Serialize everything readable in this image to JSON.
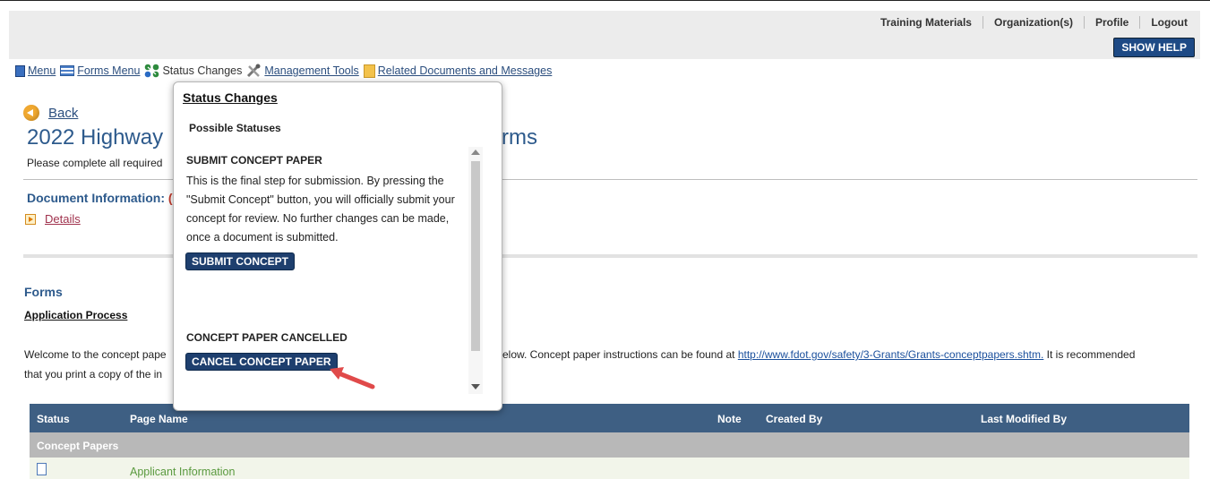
{
  "top_links": [
    "Training Materials",
    "Organization(s)",
    "Profile",
    "Logout"
  ],
  "show_help": "SHOW HELP",
  "menubar": {
    "menu": "Menu",
    "forms_menu": "Forms Menu",
    "status_changes": "Status Changes",
    "management_tools": "Management Tools",
    "related_docs": "Related Documents and Messages"
  },
  "back": "Back",
  "title_left": "2022 Highway",
  "title_right": "rms",
  "subtitle": "Please complete all required",
  "doc_info_label": "Document Information:",
  "doc_info_value": "(",
  "details": "Details",
  "forms_heading": "Forms",
  "application_process": "Application Process",
  "welcome_line1": "Welcome to the concept pape",
  "welcome_line2": "that you print a copy of the in",
  "below_text": "elow. Concept paper instructions can be found at ",
  "below_link": "http://www.fdot.gov/safety/3-Grants/Grants-conceptpapers.shtm.",
  "below_tail": " It is recommended",
  "popup": {
    "title": "Status Changes",
    "subtitle": "Possible Statuses",
    "section1_heading": "SUBMIT CONCEPT PAPER",
    "section1_desc": "This is the final step for submission. By pressing the \"Submit Concept\" button, you will officially submit your concept for review. No further changes can be made, once a document is submitted.",
    "section1_button": "SUBMIT CONCEPT",
    "section2_heading": "CONCEPT PAPER CANCELLED",
    "section2_button": "CANCEL CONCEPT PAPER"
  },
  "table": {
    "headers": {
      "status": "Status",
      "page_name": "Page Name",
      "note": "Note",
      "created_by": "Created By",
      "last_modified_by": "Last Modified By"
    },
    "group": "Concept Papers",
    "rows": [
      {
        "page_name": "Applicant Information"
      }
    ]
  },
  "colors": {
    "header_blue": "#3e5f83",
    "button_blue": "#1e3f6e",
    "title_blue": "#2d5a8c",
    "annotation_arrow": "#e04a4a"
  }
}
